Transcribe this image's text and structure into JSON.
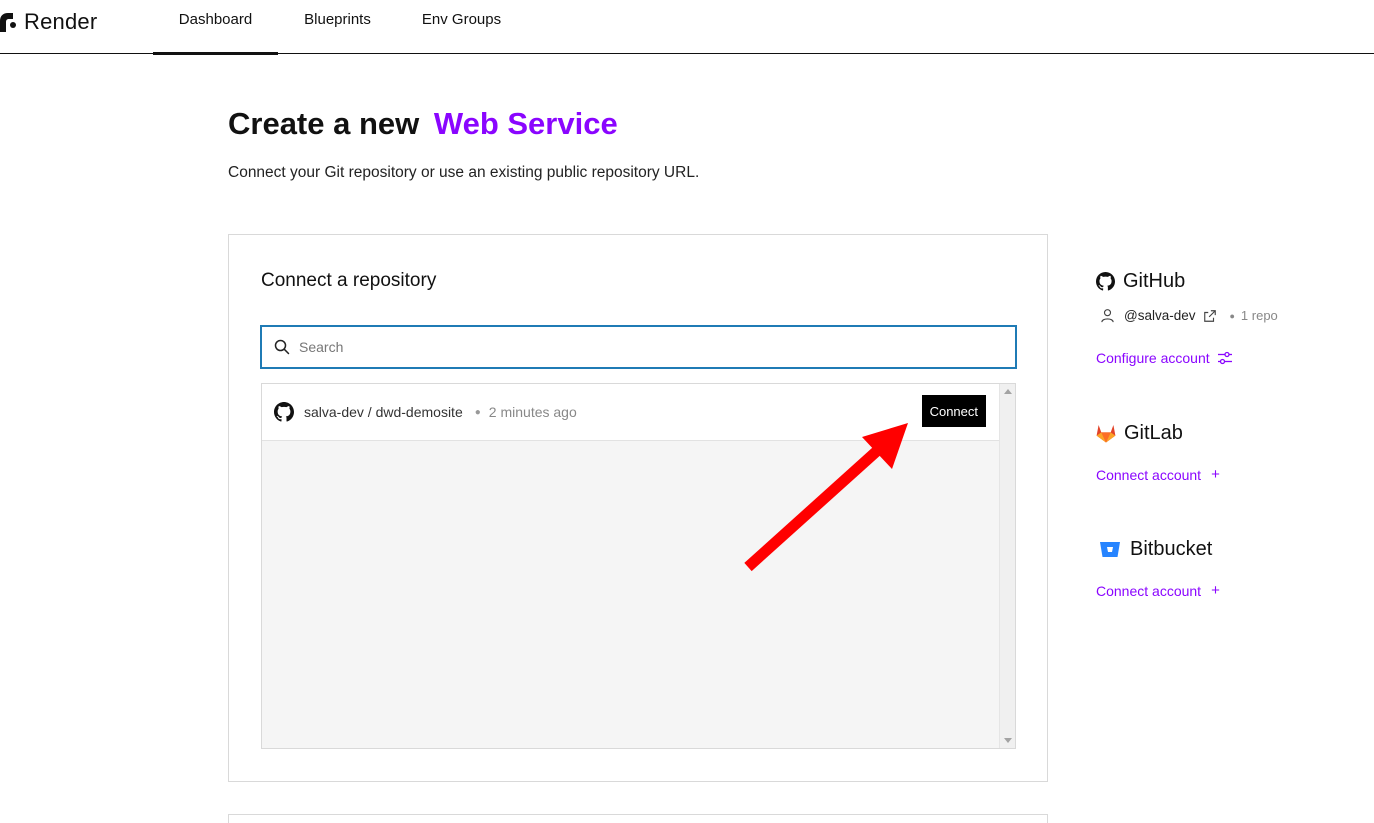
{
  "brand": {
    "name": "Render"
  },
  "nav": {
    "tabs": [
      {
        "label": "Dashboard",
        "active": true
      },
      {
        "label": "Blueprints",
        "active": false
      },
      {
        "label": "Env Groups",
        "active": false
      }
    ]
  },
  "page": {
    "title_prefix": "Create a new",
    "title_accent": "Web Service",
    "subtitle": "Connect your Git repository or use an existing public repository URL."
  },
  "repo_card": {
    "title": "Connect a repository",
    "search": {
      "placeholder": "Search",
      "value": ""
    },
    "repos": [
      {
        "name": "salva-dev / dwd-demosite",
        "updated": "2 minutes ago",
        "action_label": "Connect",
        "icon": "github-icon"
      }
    ]
  },
  "providers": {
    "github": {
      "name": "GitHub",
      "icon": "github-icon",
      "account": "@salva-dev",
      "repo_count": "1 repo",
      "link_label": "Configure account"
    },
    "gitlab": {
      "name": "GitLab",
      "icon": "gitlab-icon",
      "link_label": "Connect account",
      "link_suffix": "+"
    },
    "bitbucket": {
      "name": "Bitbucket",
      "icon": "bitbucket-icon",
      "link_label": "Connect account",
      "link_suffix": "+"
    }
  },
  "colors": {
    "accent": "#8a05ff",
    "search_focus_border": "#1f7bb5",
    "annotation_arrow": "#ff0000",
    "button_bg": "#000000"
  }
}
